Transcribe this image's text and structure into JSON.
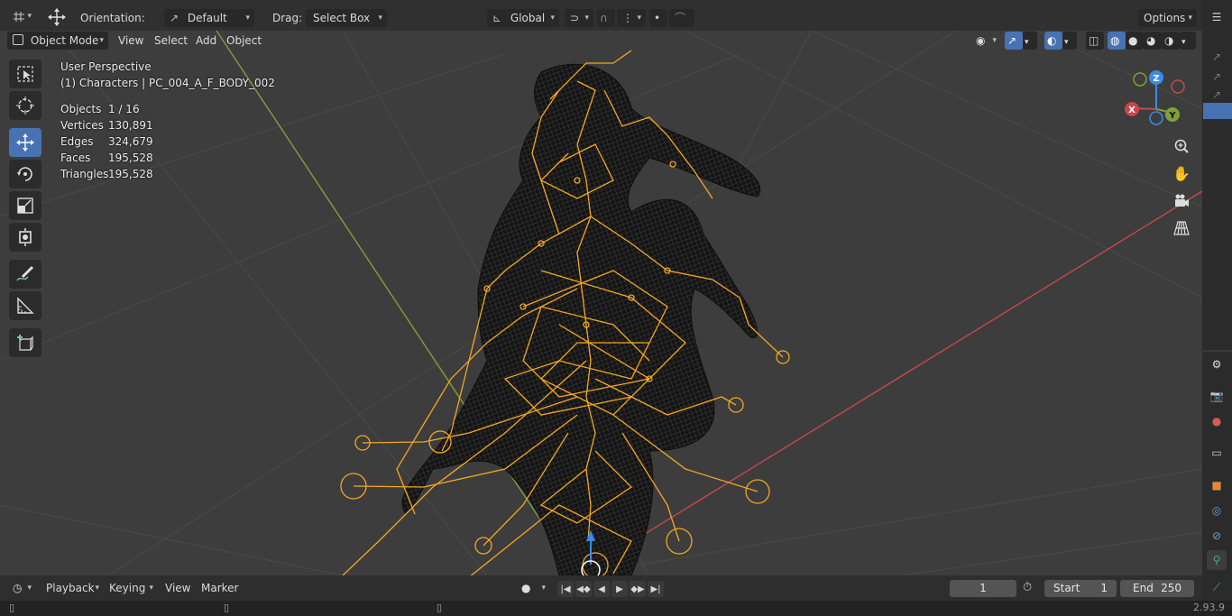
{
  "header": {
    "orientation_label": "Orientation:",
    "orientation_value": "Default",
    "drag_label": "Drag:",
    "drag_value": "Select Box",
    "transform_space": "Global",
    "options_label": "Options"
  },
  "menu": {
    "mode": "Object Mode",
    "view": "View",
    "select": "Select",
    "add": "Add",
    "object": "Object"
  },
  "overlay": {
    "perspective": "User Perspective",
    "active": "(1) Characters | PC_004_A_F_BODY_002",
    "stats": [
      {
        "label": "Objects",
        "value": "1 / 16"
      },
      {
        "label": "Vertices",
        "value": "130,891"
      },
      {
        "label": "Edges",
        "value": "324,679"
      },
      {
        "label": "Faces",
        "value": "195,528"
      },
      {
        "label": "Triangles",
        "value": "195,528"
      }
    ]
  },
  "gizmo": {
    "z": "Z",
    "y": "Y",
    "x": "X"
  },
  "timeline": {
    "playback": "Playback",
    "keying": "Keying",
    "view": "View",
    "marker": "Marker",
    "current_frame": "1",
    "start_label": "Start",
    "start_value": "1",
    "end_label": "End",
    "end_value": "250"
  },
  "status": {
    "version": "2.93.9"
  },
  "colors": {
    "accent": "#4772b3",
    "armature": "#f5a623",
    "axis_x": "#c8474e",
    "axis_y": "#7fa03a",
    "axis_z": "#3a8ce8"
  }
}
